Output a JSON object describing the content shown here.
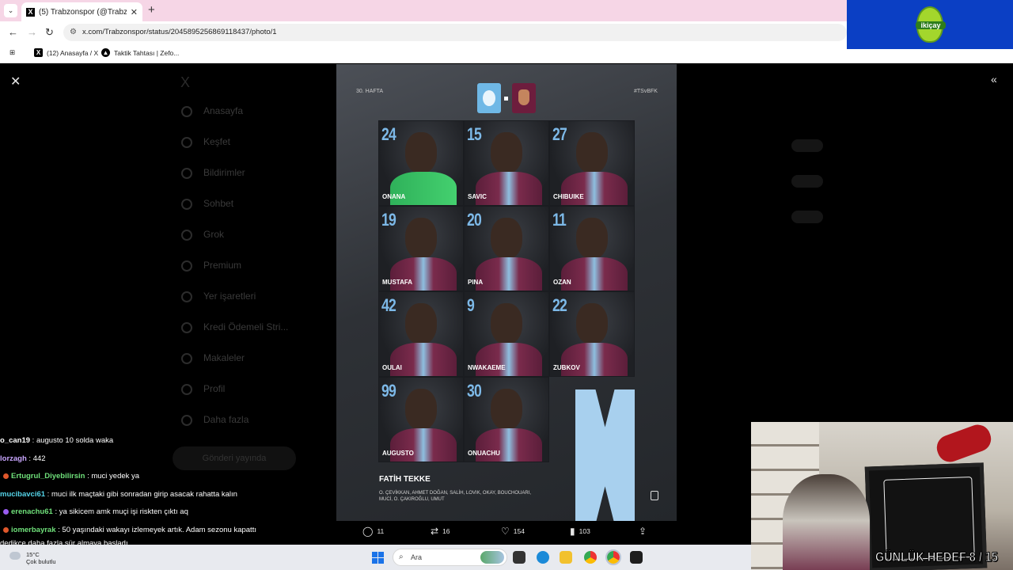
{
  "browser": {
    "tab_title": "(5) Trabzonspor (@Trabzonspor",
    "url": "x.com/Trabzonspor/status/2045895256869118437/photo/1",
    "bookmarks": [
      {
        "label": "(12) Anasayfa / X"
      },
      {
        "label": "Taktik Tahtası | Zefo..."
      }
    ]
  },
  "sponsor": {
    "label": "ikiçay"
  },
  "sidebar": {
    "items": [
      "Anasayfa",
      "Keşfet",
      "Bildirimler",
      "Sohbet",
      "Grok",
      "Premium",
      "Yer işaretleri",
      "Kredi Ödemeli Stri...",
      "Makaleler",
      "Profil",
      "Daha fazla"
    ],
    "post_button": "Gönderi yayında"
  },
  "poster": {
    "week": "30. HAFTA",
    "hashtag": "#TSvBFK",
    "coach": "FATİH TEKKE",
    "subs": "O. ÇEVİKKAN, AHMET DOĞAN, SALİH, LOVIK, OKAY, BOUCHOUARI, MUCİ, O. ÇAKIROĞLU, UMUT",
    "players": [
      {
        "num": "24",
        "name": "ONANA"
      },
      {
        "num": "15",
        "name": "SAVIC"
      },
      {
        "num": "27",
        "name": "CHIBUIKE"
      },
      {
        "num": "19",
        "name": "MUSTAFA"
      },
      {
        "num": "20",
        "name": "PINA"
      },
      {
        "num": "11",
        "name": "OZAN"
      },
      {
        "num": "42",
        "name": "OULAI"
      },
      {
        "num": "9",
        "name": "NWAKAEME"
      },
      {
        "num": "22",
        "name": "ZUBKOV"
      },
      {
        "num": "99",
        "name": "AUGUSTO"
      },
      {
        "num": "30",
        "name": "ONUACHU"
      }
    ]
  },
  "actions": {
    "replies": "11",
    "reposts": "16",
    "likes": "154",
    "views": "103"
  },
  "chat": [
    {
      "user": "o_can19",
      "text": " : augusto 10 solda waka",
      "color": "#ffffff",
      "badge": ""
    },
    {
      "user": "lorzagh",
      "text": " : 442",
      "color": "#c9a6ff",
      "badge": ""
    },
    {
      "user": "Ertugrul_Diyebilirsin",
      "text": " : muci yedek ya",
      "color": "#6fe07a",
      "badge": "#e0572b"
    },
    {
      "user": "mucibavci61",
      "text": " : muci ilk maçtaki gibi sonradan girip asacak rahatta kalın",
      "color": "#55d4e9",
      "badge": ""
    },
    {
      "user": "erenachu61",
      "text": " : ya sikicem amk muçi işi riskten çıktı aq",
      "color": "#6fe07a",
      "badge": "#9a5cf0"
    },
    {
      "user": "iomerbayrak",
      "text": " : 50 yaşındaki wakayı izlemeyek artık. Adam sezonu kapattı",
      "color": "#6fe07a",
      "badge": "#e0572b"
    },
    {
      "user": "",
      "text": "dedikçe daha fazla sür almaya başladı",
      "color": "#ffffff",
      "badge": ""
    }
  ],
  "stream": {
    "goal_text": "GÜNLÜK HEDEF 8 / 15"
  },
  "taskbar": {
    "temp": "15°C",
    "weather": "Çok bulutlu",
    "search_placeholder": "Ara"
  },
  "colors": {
    "accent_blue": "#7db9e8",
    "bordo": "#6d1d3d"
  }
}
